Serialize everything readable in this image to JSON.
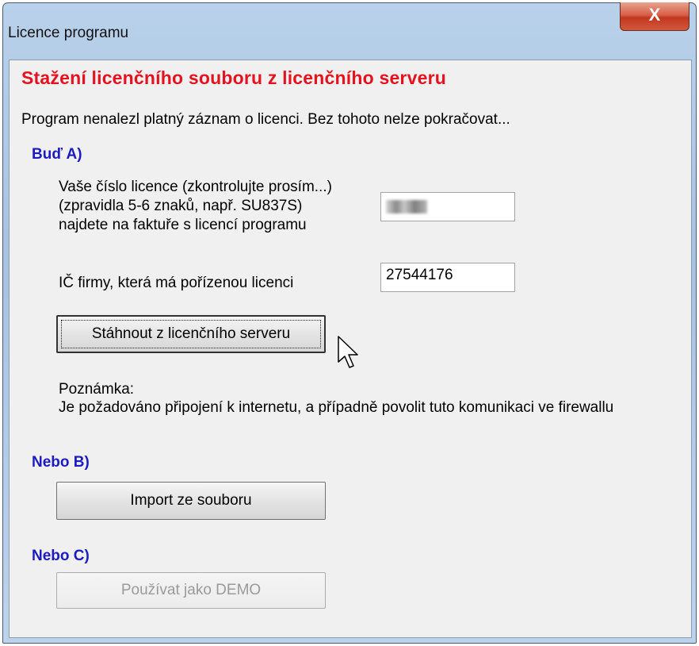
{
  "window": {
    "title": "Licence programu",
    "close_glyph": "X"
  },
  "heading": "Stažení licenčního souboru z licenčního serveru",
  "intro": "Program nenalezl platný záznam o licenci. Bez tohoto nelze pokračovat...",
  "option_a": {
    "title": "Buď A)",
    "license_label_line1": "Vaše číslo licence (zkontrolujte prosím...)",
    "license_label_line2": "(zpravidla 5-6 znaků, např. SU837S)",
    "license_label_line3": "najdete na faktuře s licencí programu",
    "ico_label": "IČ firmy, která má pořízenou licenci",
    "ico_value": "27544176",
    "download_button": "Stáhnout z licenčního serveru",
    "note_title": "Poznámka:",
    "note_text": "Je požadováno připojení k internetu, a případně povolit tuto komunikaci ve firewallu"
  },
  "option_b": {
    "title": "Nebo B)",
    "import_button": "Import ze souboru"
  },
  "option_c": {
    "title": "Nebo C)",
    "demo_button": "Používat jako DEMO"
  },
  "colors": {
    "heading": "#e3131f",
    "section": "#1b1bc0",
    "disabled_text": "#9a9a9a"
  },
  "icons": {
    "close": "close-icon",
    "cursor": "mouse-pointer-icon"
  }
}
